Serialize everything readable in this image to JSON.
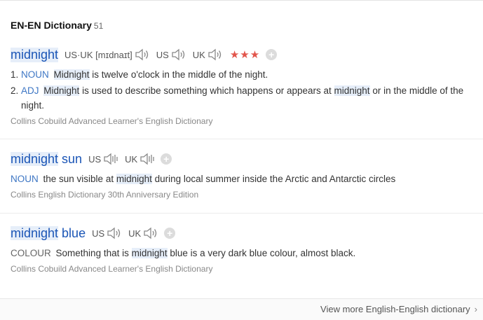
{
  "header": {
    "title": "EN-EN Dictionary",
    "count": "51"
  },
  "entries": [
    {
      "word": "midnight",
      "pron": {
        "usuk_label": "US·UK",
        "usuk_ipa": "[mɪdnaɪt]",
        "us_label": "US",
        "uk_label": "UK"
      },
      "stars": "★★★",
      "plus": "+",
      "defs": [
        {
          "num": "1.",
          "pos": "NOUN",
          "hl": "Midnight",
          "rest": " is twelve o'clock in the middle of the night."
        },
        {
          "num": "2.",
          "pos": "ADJ",
          "hl": "Midnight",
          "mid": " is used to describe something which happens or appears at ",
          "hl2": "midnight",
          "rest": " or in the middle of the night."
        }
      ],
      "source": "Collins Cobuild Advanced Learner's English Dictionary"
    },
    {
      "word_hl": "midnight",
      "word_rest": " sun",
      "pron": {
        "us_label": "US",
        "uk_label": "UK"
      },
      "plus": "+",
      "pos": "NOUN",
      "pre": "the sun visible at ",
      "hl": "midnight",
      "rest": " during local summer inside the Arctic and Antarctic circles",
      "source": "Collins English Dictionary 30th Anniversary Edition"
    },
    {
      "word_hl": "midnight",
      "word_rest": " blue",
      "pron": {
        "us_label": "US",
        "uk_label": "UK"
      },
      "plus": "+",
      "pos": "COLOUR",
      "pre": "Something that is ",
      "hl": "midnight",
      "rest": " blue is a very dark blue colour, almost black.",
      "source": "Collins Cobuild Advanced Learner's English Dictionary"
    }
  ],
  "footer": {
    "more_label": "View more English-English dictionary",
    "chevron": "›"
  },
  "colors": {
    "link": "#1a55b6",
    "highlight": "#e6eef9",
    "stars": "#e2554b"
  },
  "icons": {
    "speaker": "speaker-icon",
    "add": "add-icon",
    "chevron": "chevron-right-icon"
  }
}
